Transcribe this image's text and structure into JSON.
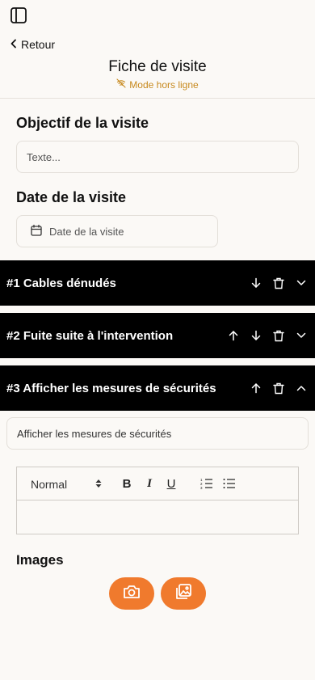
{
  "nav": {
    "back_label": "Retour",
    "title": "Fiche de visite",
    "offline_label": "Mode hors ligne"
  },
  "form": {
    "objective_label": "Objectif de la visite",
    "objective_placeholder": "Texte...",
    "date_label": "Date de la visite",
    "date_placeholder": "Date de la visite"
  },
  "sections": [
    {
      "title": "#1 Cables dénudés",
      "expanded": false
    },
    {
      "title": "#2 Fuite suite à l'intervention",
      "expanded": false
    },
    {
      "title": "#3 Afficher les mesures de sécurités",
      "expanded": true
    }
  ],
  "expanded_section": {
    "title_value": "Afficher les mesures de sécurités",
    "editor": {
      "format_value": "Normal",
      "bold": "B",
      "italic": "I",
      "underline": "U"
    },
    "images_label": "Images"
  },
  "colors": {
    "accent": "#f07a2d",
    "offline": "#c7891d",
    "section_bg": "#000000",
    "page_bg": "#fbf9f6"
  },
  "icons": {
    "sidebar": "sidebar-toggle-icon",
    "back": "chevron-left-icon",
    "offline": "wifi-off-icon",
    "calendar": "calendar-icon",
    "up": "arrow-up-icon",
    "down": "arrow-down-icon",
    "delete": "trash-icon",
    "collapse": "chevron-down-icon",
    "expand": "chevron-up-icon",
    "camera": "camera-icon",
    "gallery": "image-gallery-icon"
  }
}
